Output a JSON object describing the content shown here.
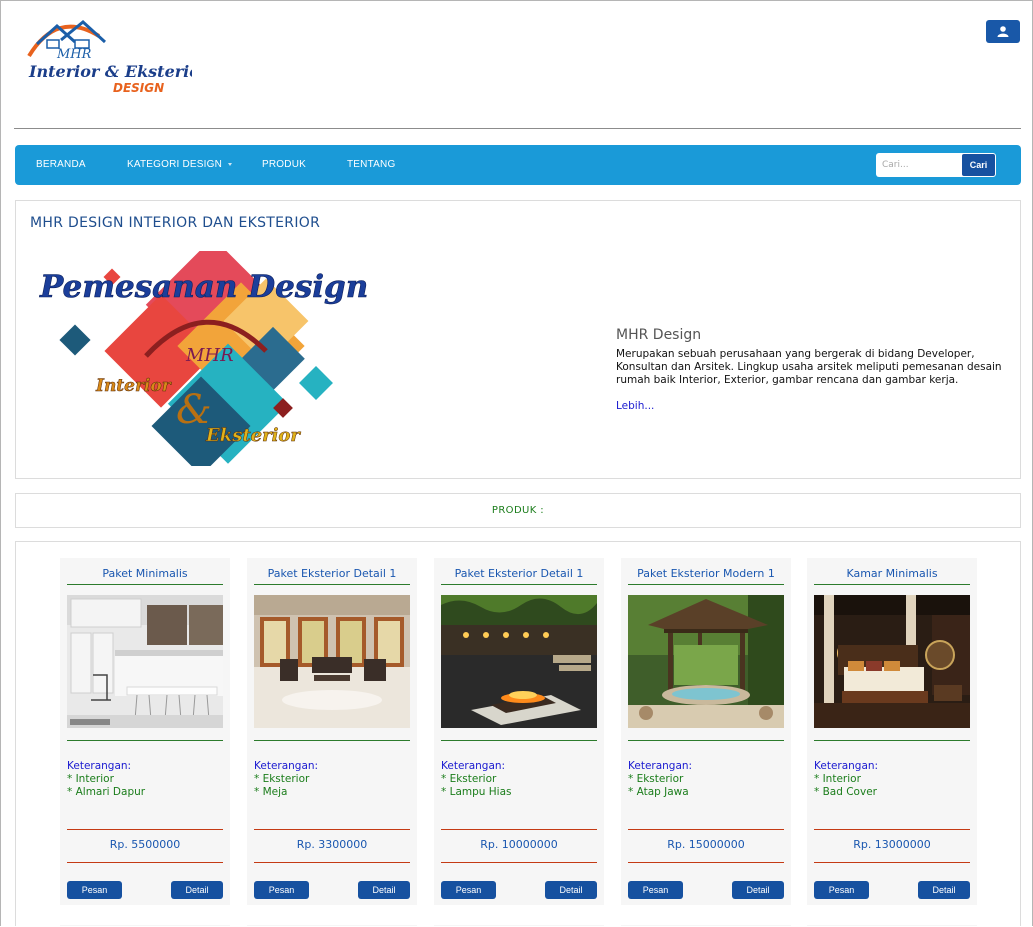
{
  "header": {
    "logo_lines": [
      "MHR",
      "Interior & Eksterior",
      "DESIGN"
    ],
    "user_icon": "user-icon"
  },
  "nav": {
    "items": [
      {
        "label": "BERANDA"
      },
      {
        "label": "KATEGORI DESIGN",
        "dropdown": true
      },
      {
        "label": "PRODUK"
      },
      {
        "label": "TENTANG"
      }
    ],
    "search_placeholder": "Cari...",
    "search_button": "Cari"
  },
  "hero": {
    "title": "MHR DESIGN INTERIOR DAN EKSTERIOR",
    "image_text": [
      "Pemesanan Design",
      "MHR",
      "Interior",
      "&",
      "Eksterior"
    ],
    "about_title": "MHR Design",
    "about_text": "Merupakan sebuah perusahaan yang bergerak di bidang Developer, Konsultan dan Arsitek. Lingkup usaha arsitek meliputi pemesanan desain rumah baik Interior, Exterior, gambar rencana dan gambar kerja.",
    "about_link": "Lebih..."
  },
  "products_header": "PRODUK :",
  "products": [
    {
      "title": "Paket Minimalis",
      "ket_label": "Keterangan:",
      "ket": [
        "* Interior",
        "* Almari Dapur"
      ],
      "price": "Rp. 5500000",
      "pesan": "Pesan",
      "detail": "Detail",
      "image": "kitchen"
    },
    {
      "title": "Paket Eksterior Detail 1",
      "ket_label": "Keterangan:",
      "ket": [
        "* Eksterior",
        "* Meja"
      ],
      "price": "Rp. 3300000",
      "pesan": "Pesan",
      "detail": "Detail",
      "image": "lounge"
    },
    {
      "title": "Paket Eksterior Detail 1",
      "ket_label": "Keterangan:",
      "ket": [
        "* Eksterior",
        "* Lampu Hias"
      ],
      "price": "Rp. 10000000",
      "pesan": "Pesan",
      "detail": "Detail",
      "image": "fire-pit"
    },
    {
      "title": "Paket Eksterior Modern 1",
      "ket_label": "Keterangan:",
      "ket": [
        "* Eksterior",
        "* Atap Jawa"
      ],
      "price": "Rp. 15000000",
      "pesan": "Pesan",
      "detail": "Detail",
      "image": "gazebo"
    },
    {
      "title": "Kamar Minimalis",
      "ket_label": "Keterangan:",
      "ket": [
        "* Interior",
        "* Bad Cover"
      ],
      "price": "Rp. 13000000",
      "pesan": "Pesan",
      "detail": "Detail",
      "image": "bedroom"
    }
  ],
  "colors": {
    "nav_bg": "#1a9ad8",
    "button_blue": "#1651a0",
    "title_blue": "#1a57b0",
    "green_text": "#1b7d1b",
    "price_rule": "#c43a14"
  }
}
